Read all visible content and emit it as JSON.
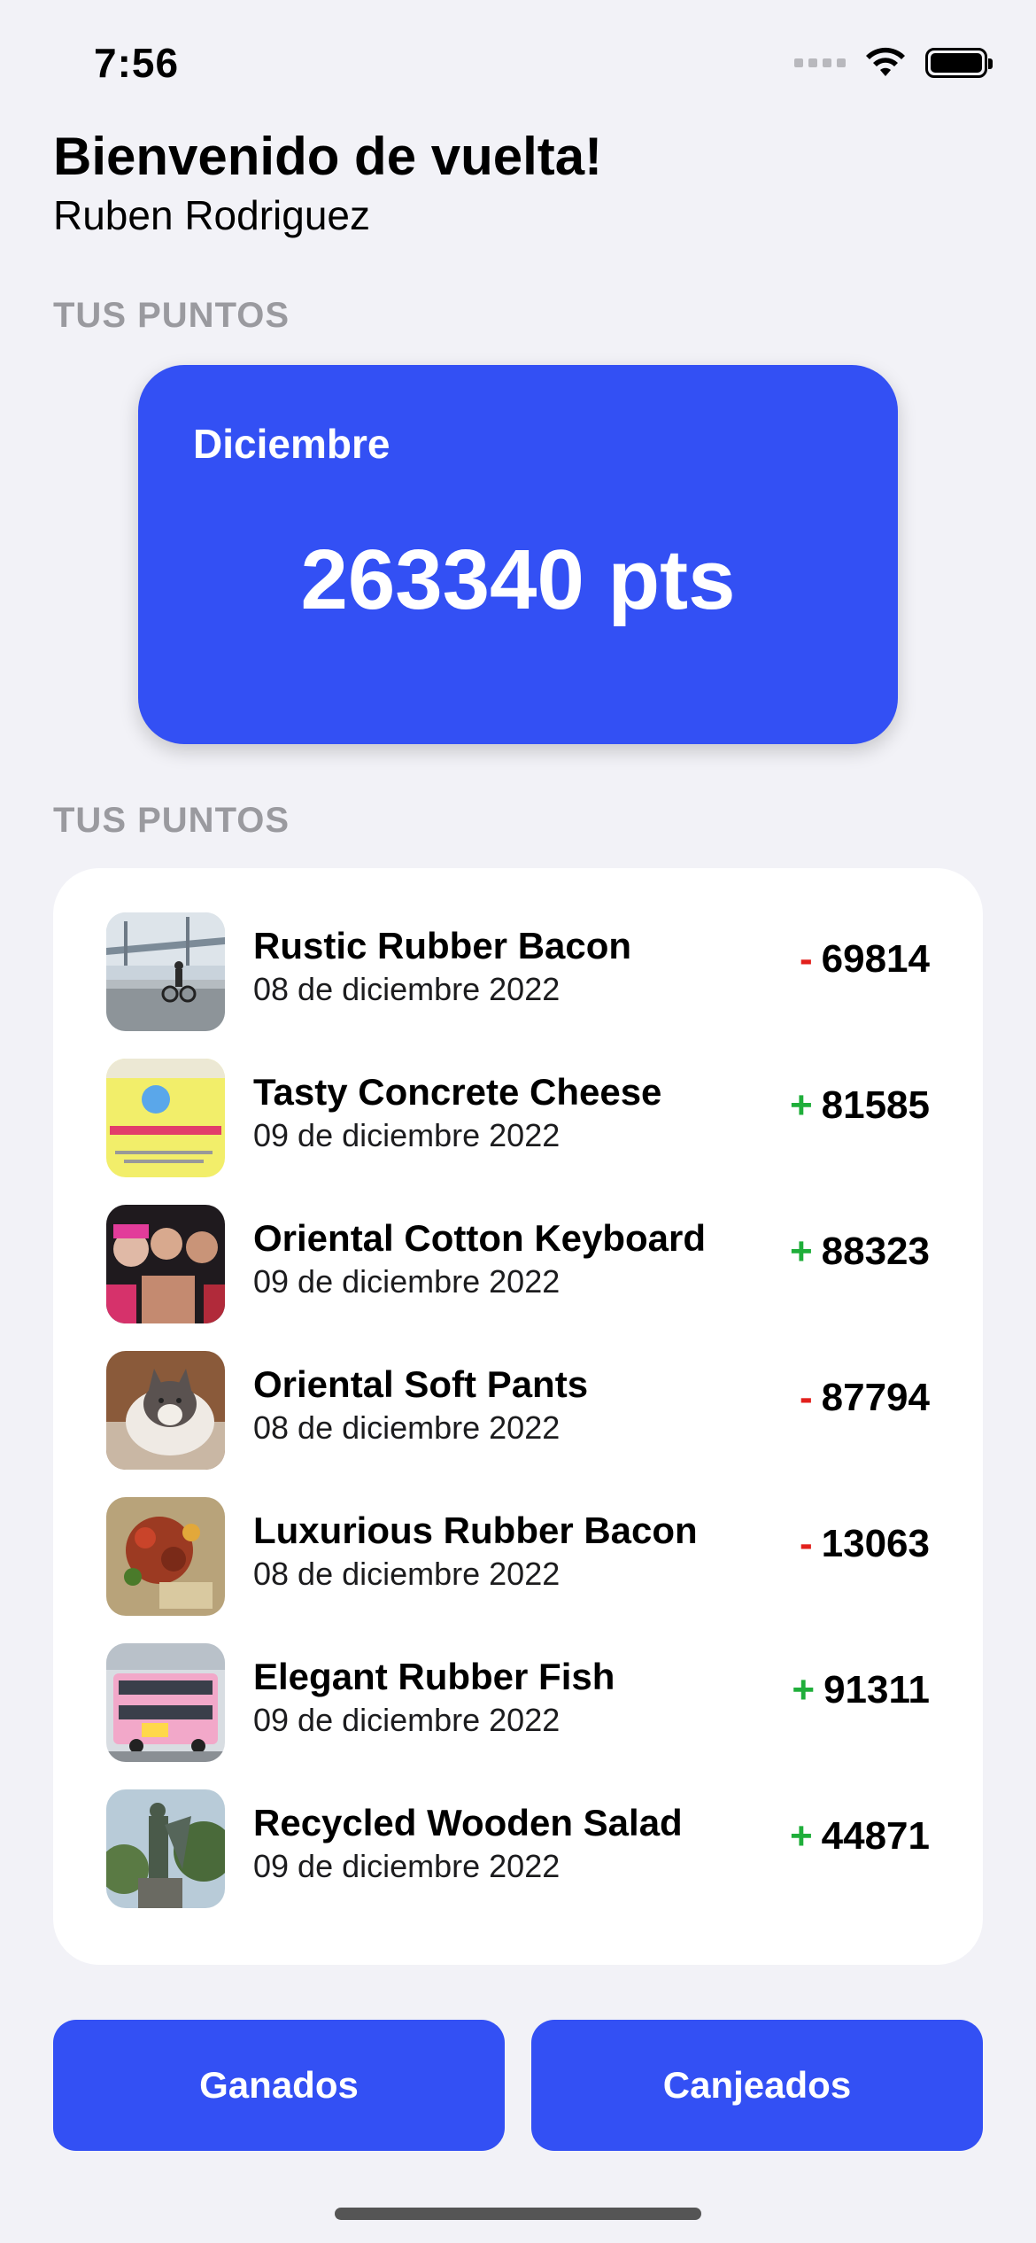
{
  "status_bar": {
    "time": "7:56"
  },
  "header": {
    "greeting": "Bienvenido de vuelta!",
    "user_name": "Ruben Rodriguez"
  },
  "sections": {
    "points_label": "TUS PUNTOS",
    "list_label": "TUS PUNTOS"
  },
  "points_card": {
    "month": "Diciembre",
    "points": "263340 pts",
    "color": "#3350f4"
  },
  "transactions": [
    {
      "title": "Rustic Rubber Bacon",
      "date": "08 de diciembre 2022",
      "sign": "-",
      "amount": "69814",
      "thumb": "bridge-cyclist-photo"
    },
    {
      "title": "Tasty Concrete Cheese",
      "date": "09 de diciembre 2022",
      "sign": "+",
      "amount": "81585",
      "thumb": "book-cover-photo"
    },
    {
      "title": "Oriental Cotton Keyboard",
      "date": "09 de diciembre 2022",
      "sign": "+",
      "amount": "88323",
      "thumb": "party-people-photo"
    },
    {
      "title": "Oriental Soft Pants",
      "date": "08 de diciembre 2022",
      "sign": "-",
      "amount": "87794",
      "thumb": "cat-photo"
    },
    {
      "title": "Luxurious Rubber Bacon",
      "date": "08 de diciembre 2022",
      "sign": "-",
      "amount": "13063",
      "thumb": "food-dish-photo"
    },
    {
      "title": "Elegant Rubber Fish",
      "date": "09 de diciembre 2022",
      "sign": "+",
      "amount": "91311",
      "thumb": "pink-bus-photo"
    },
    {
      "title": "Recycled Wooden Salad",
      "date": "09 de diciembre 2022",
      "sign": "+",
      "amount": "44871",
      "thumb": "statue-photo"
    }
  ],
  "buttons": {
    "earned": "Ganados",
    "redeemed": "Canjeados"
  },
  "colors": {
    "accent": "#3350f4",
    "negative": "#e2201c",
    "positive": "#1fae3a"
  }
}
